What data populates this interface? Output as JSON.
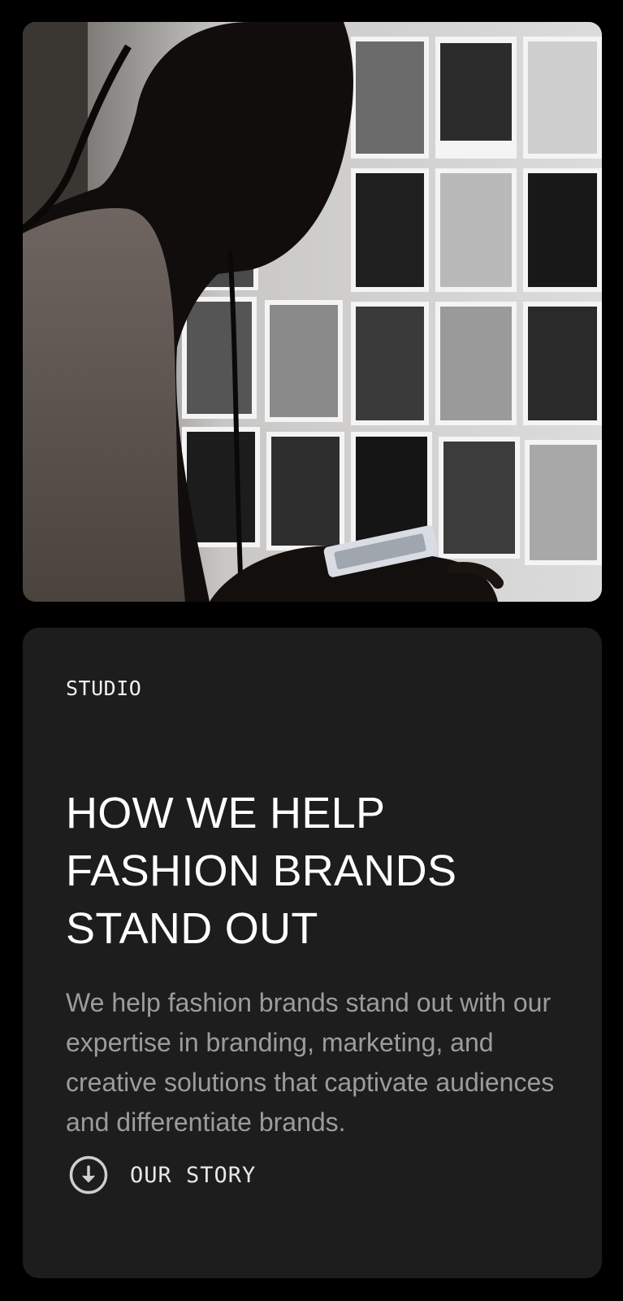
{
  "hero": {
    "image": "photo-woman-viewing-black-and-white-fashion-prints"
  },
  "card": {
    "eyebrow": "STUDIO",
    "headline_lines": [
      "HOW WE HELP",
      "FASHION BRANDS",
      "STAND OUT"
    ],
    "body": "We help fashion brands stand out with our expertise in branding, marketing, and creative solutions that captivate audiences and differentiate brands.",
    "cta": {
      "icon": "arrow-down-circle-icon",
      "label": "OUR STORY"
    }
  },
  "colors": {
    "page_background": "#000000",
    "card_background": "#1d1d1d",
    "headline": "#ffffff",
    "body_text": "#9c9c9c"
  }
}
